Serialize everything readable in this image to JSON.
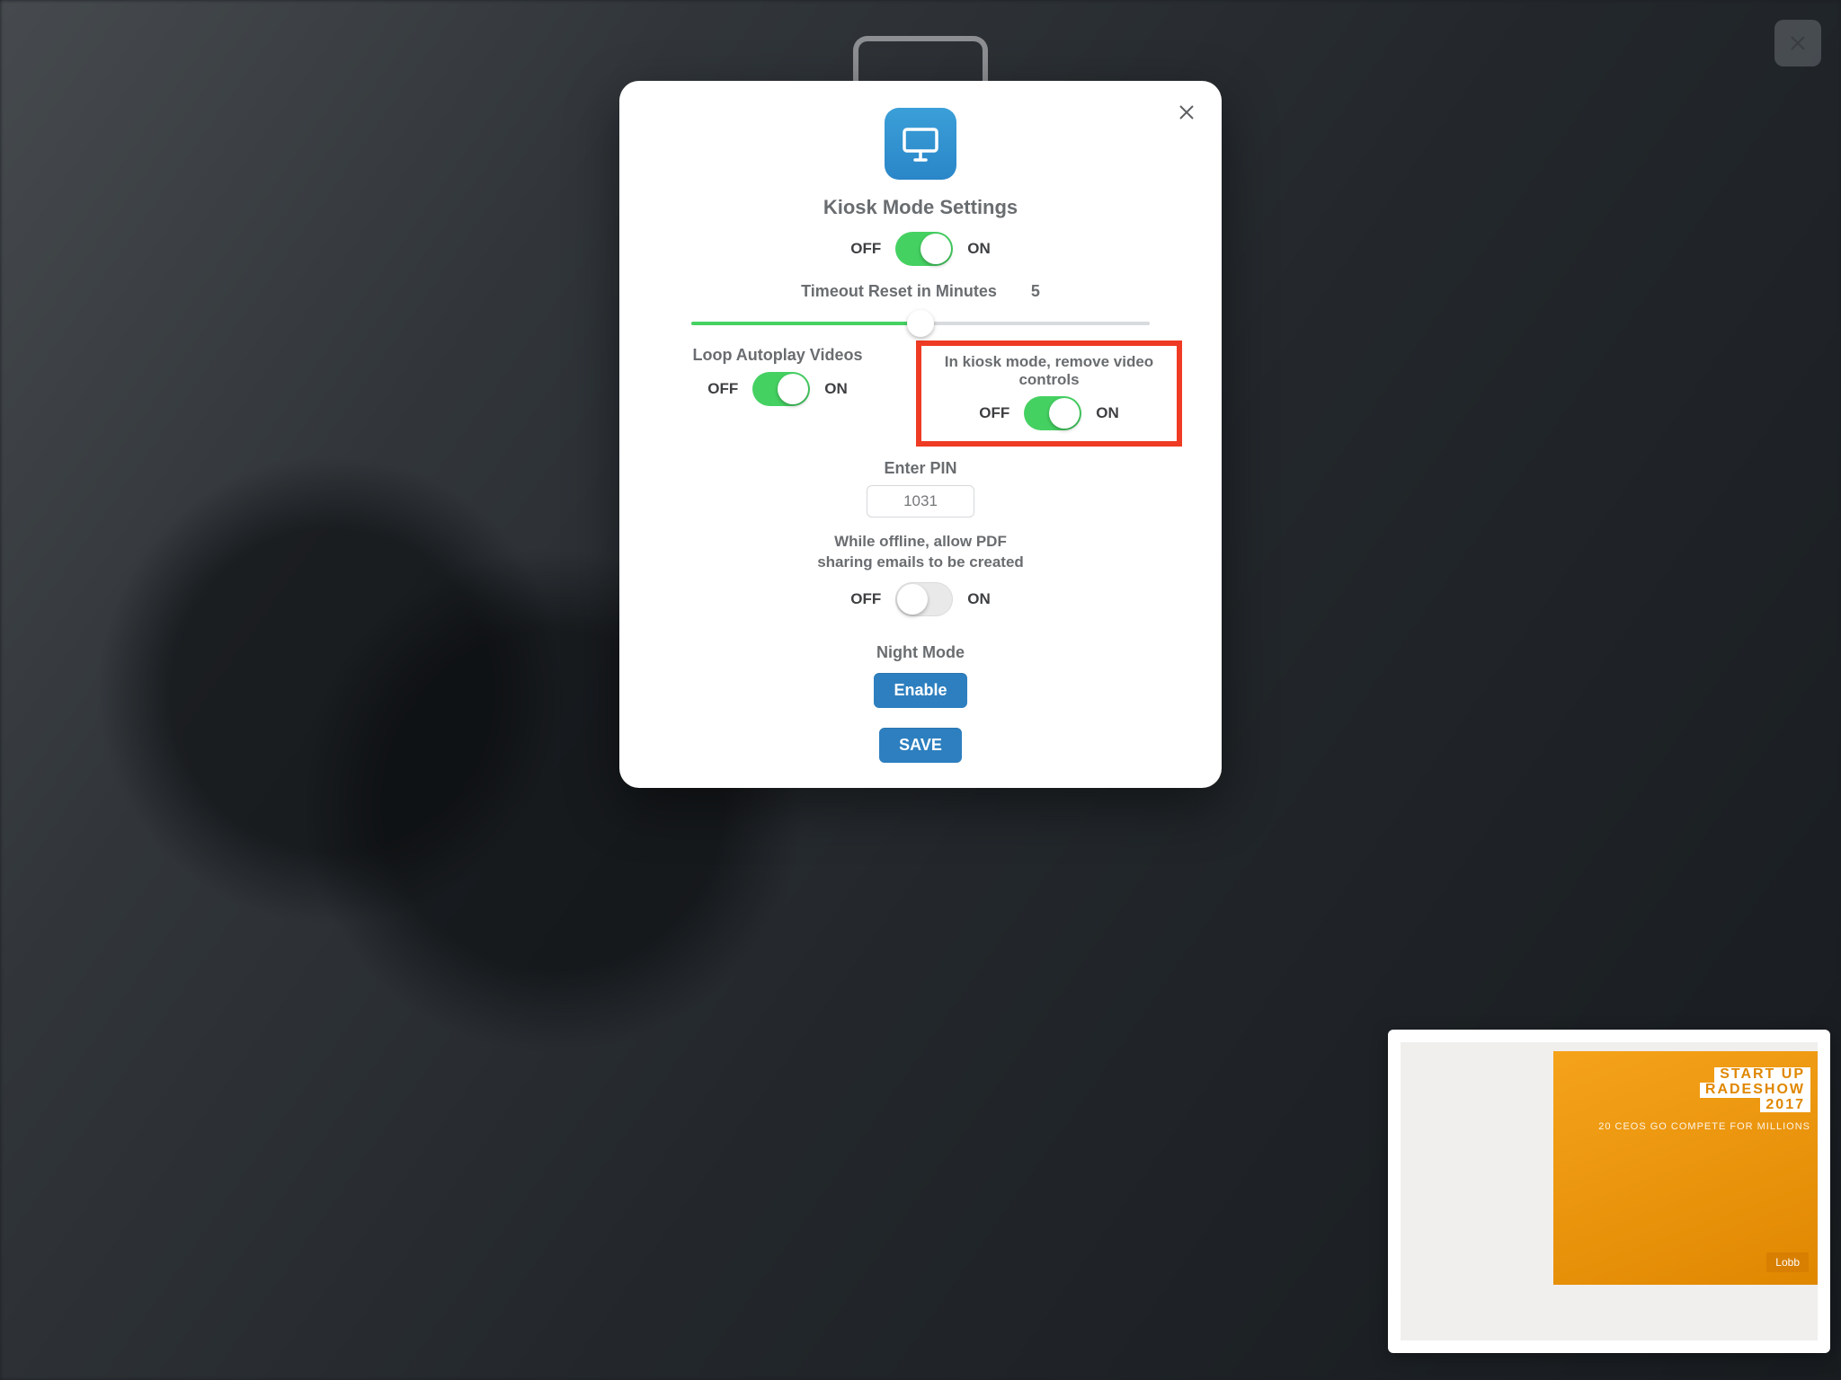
{
  "outer": {
    "close_label": "Close"
  },
  "modal": {
    "icon": "kiosk-app-icon",
    "title": "Kiosk Mode Settings",
    "close_label": "Close",
    "master_toggle": {
      "off": "OFF",
      "on": "ON",
      "state": "on"
    },
    "timeout": {
      "label": "Timeout Reset in Minutes",
      "value": "5",
      "min": 0,
      "max": 10,
      "percent": 50
    },
    "loop_videos": {
      "label": "Loop Autoplay Videos",
      "off": "OFF",
      "on": "ON",
      "state": "on"
    },
    "remove_controls": {
      "label": "In kiosk mode, remove video controls",
      "off": "OFF",
      "on": "ON",
      "state": "on",
      "highlighted": true
    },
    "pin": {
      "label": "Enter PIN",
      "value": "1031"
    },
    "offline_pdf": {
      "label_line1": "While offline, allow PDF",
      "label_line2": "sharing emails to be created",
      "off": "OFF",
      "on": "ON",
      "state": "off"
    },
    "night_mode": {
      "title": "Night Mode",
      "enable": "Enable"
    },
    "save": "SAVE"
  },
  "background_promo": {
    "line1": "START UP",
    "line2": "RADESHOW",
    "line3": "2017",
    "sub": "20 CEOS GO COMPETE FOR MILLIONS",
    "chip": "Lobb"
  }
}
